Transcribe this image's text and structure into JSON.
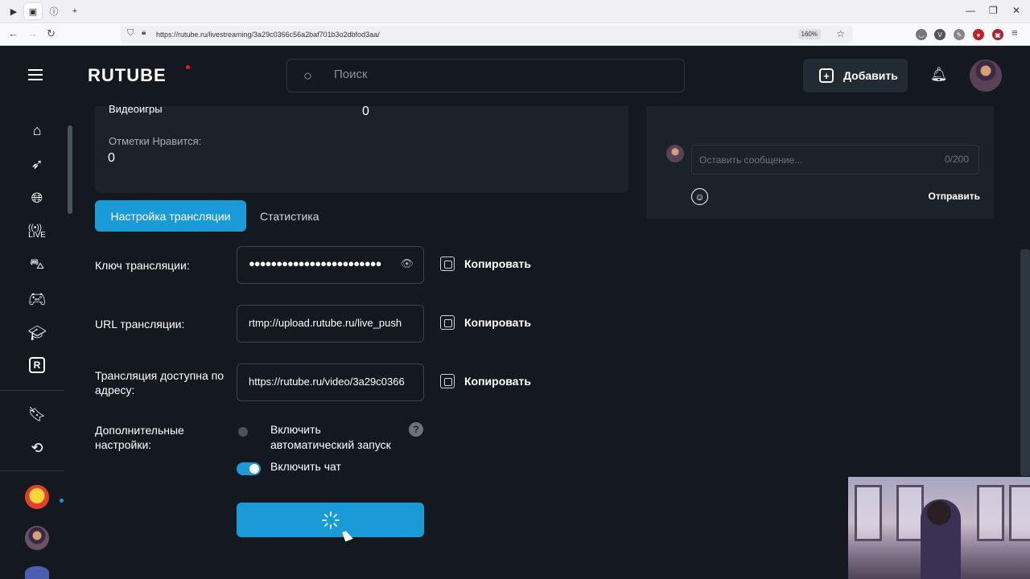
{
  "browser": {
    "url": "https://rutube.ru/livestreaming/3a29c0366c56a2baf701b3o2dbfod3aa/",
    "zoom": "160%"
  },
  "header": {
    "logo": "RUTUBE",
    "search_placeholder": "Поиск",
    "add_label": "Добавить"
  },
  "stats": {
    "category_label": "Видеоигры",
    "category_value": "0",
    "likes_label": "Отметки Нравится:",
    "likes_value": "0"
  },
  "tabs": {
    "settings": "Настройка трансляции",
    "statistics": "Статистика"
  },
  "stream": {
    "key_label": "Ключ трансляции:",
    "key_value": "●●●●●●●●●●●●●●●●●●●●●●●●",
    "url_label": "URL трансляции:",
    "url_value": "rtmp://upload.rutube.ru/live_push",
    "address_label": "Трансляция доступна по адресу:",
    "address_value": "https://rutube.ru/video/3a29c0366",
    "copy_label": "Копировать",
    "extra_label": "Дополнительные настройки:",
    "autostart_label": "Включить автоматический запуск",
    "autostart_enabled": false,
    "chat_label": "Включить чат",
    "chat_enabled": true,
    "help_glyph": "?"
  },
  "chat": {
    "placeholder": "Оставить сообщение...",
    "counter": "0/200",
    "send_label": "Отправить"
  },
  "icons": {
    "sidebar": [
      "menu-icon",
      "home-icon",
      "rocket-icon",
      "globe-icon",
      "live-icon",
      "car-icon",
      "gamepad-icon",
      "graduation-cap-icon",
      "rutube-r-icon",
      "bookmark-icon",
      "history-icon"
    ]
  },
  "colors": {
    "accent": "#1a9bd7",
    "background": "#14191f",
    "panel": "#1c222a",
    "logo_dot": "#ed143b"
  }
}
